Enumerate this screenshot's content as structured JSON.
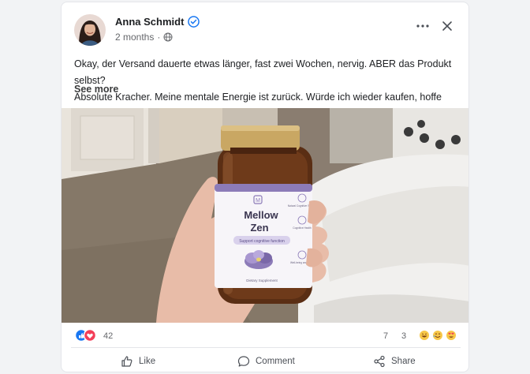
{
  "post": {
    "author": "Anna Schmidt",
    "timestamp": "2 months",
    "separator": "·",
    "text_line1": "Okay, der Versand dauerte etwas länger, fast zwei Wochen, nervig. ABER das Produkt selbst?",
    "text_line2": "Absolute Kracher. Meine mentale Energie ist zurück. Würde ich wieder kaufen, hoffe",
    "see_more": "See more"
  },
  "product": {
    "brand_mark": "M",
    "name_line1": "Mellow",
    "name_line2": "Zen",
    "tagline": "Support cognitive function",
    "claim1": "Natural Cognitive Support",
    "claim2": "Cognitive Health",
    "claim3": "Well-being and Mood",
    "footer": "Dietary Supplement"
  },
  "engagement": {
    "reaction_count": "42",
    "comment_count": "7",
    "share_count": "3"
  },
  "actions": {
    "like": "Like",
    "comment": "Comment",
    "share": "Share"
  },
  "icons": {
    "verified": "verified-badge-icon",
    "globe": "globe-icon",
    "more": "more-horizontal-icon",
    "close": "close-icon",
    "like": "thumbs-up-icon",
    "comment": "comment-bubble-icon",
    "share": "share-nodes-icon"
  },
  "colors": {
    "accent_blue": "#1877f2",
    "love_red": "#f33e58",
    "label_purple": "#8c7bb8"
  }
}
